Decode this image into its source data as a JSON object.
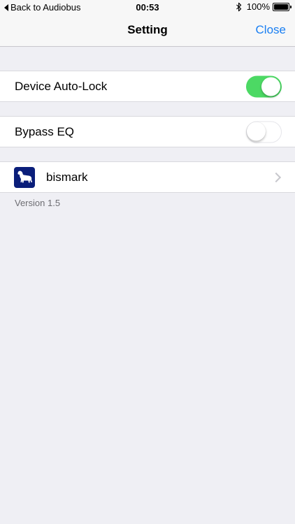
{
  "status_bar": {
    "back_label": "Back to Audiobus",
    "time": "00:53",
    "battery_text": "100%",
    "battery_level": 1.0
  },
  "nav": {
    "title": "Setting",
    "close_label": "Close"
  },
  "settings": {
    "auto_lock": {
      "label": "Device Auto-Lock",
      "enabled": true
    },
    "bypass_eq": {
      "label": "Bypass EQ",
      "enabled": false
    },
    "app_row": {
      "label": "bismark",
      "icon": "dog-icon"
    }
  },
  "footer": {
    "version": "Version 1.5"
  },
  "colors": {
    "accent": "#1a7ff2",
    "toggle_on": "#4cd964",
    "app_icon_bg": "#0a1e7a",
    "background": "#efeff4"
  }
}
